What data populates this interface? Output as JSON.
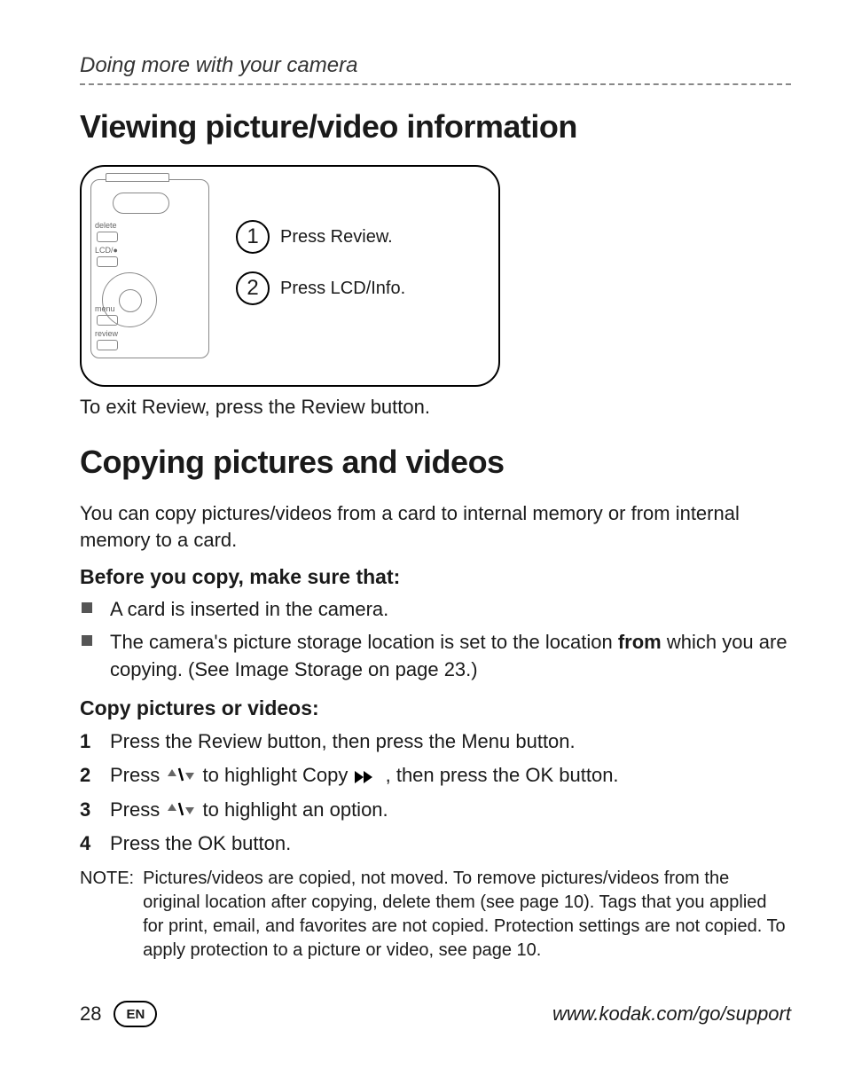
{
  "header": {
    "running_head": "Doing more with your camera"
  },
  "section1": {
    "title": "Viewing picture/video information",
    "diagram": {
      "labels": {
        "delete": "delete",
        "lcd": "LCD/●",
        "menu": "menu",
        "review": "review"
      },
      "steps": [
        {
          "num": "1",
          "text": "Press Review."
        },
        {
          "num": "2",
          "text": "Press LCD/Info."
        }
      ]
    },
    "caption": "To exit Review, press the Review button."
  },
  "section2": {
    "title": "Copying pictures and videos",
    "intro": "You can copy pictures/videos from a card to internal memory or from internal memory to a card.",
    "sub1": {
      "heading": "Before you copy, make sure that:",
      "items": [
        {
          "text": "A card is inserted in the camera."
        },
        {
          "pre": "The camera's picture storage location is set to the location ",
          "bold": "from",
          "post": " which you are copying. (See Image Storage on page 23.)"
        }
      ]
    },
    "sub2": {
      "heading": "Copy pictures or videos:",
      "steps": [
        {
          "n": "1",
          "text": "Press the Review button, then press the Menu button."
        },
        {
          "n": "2",
          "pre": "Press ",
          "mid": " to highlight Copy ",
          "post": ", then press the OK button."
        },
        {
          "n": "3",
          "pre": "Press ",
          "post": " to highlight an option."
        },
        {
          "n": "4",
          "text": "Press the OK button."
        }
      ]
    },
    "note": {
      "label": "NOTE:",
      "text": "Pictures/videos are copied, not moved. To remove pictures/videos from the original location after copying, delete them (see page 10). Tags that you applied for print, email, and favorites are not copied. Protection settings are not copied. To apply protection to a picture or video, see page 10."
    }
  },
  "footer": {
    "page": "28",
    "lang": "EN",
    "url": "www.kodak.com/go/support"
  }
}
